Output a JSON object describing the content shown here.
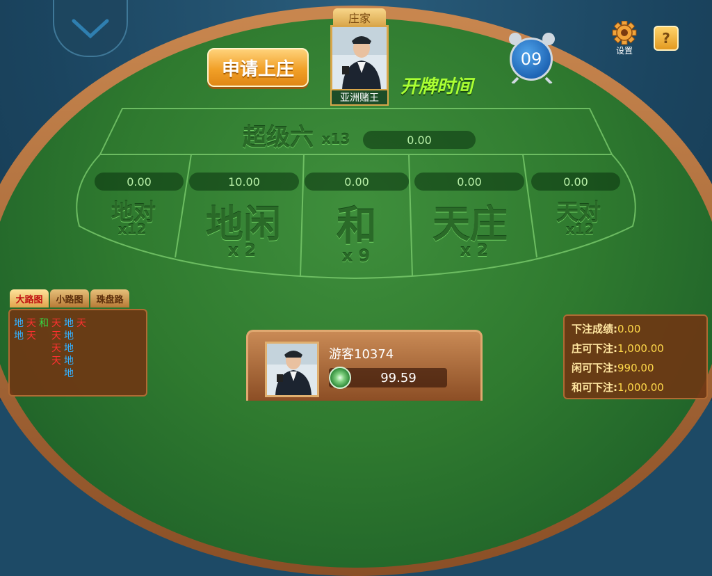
{
  "banker": {
    "tag": "庄家",
    "name": "亚洲赌王"
  },
  "apply_button": "申请上庄",
  "timer": {
    "label": "开牌时间",
    "seconds": "09"
  },
  "settings_label": "设置",
  "help_label": "?",
  "bets": {
    "super_six": {
      "label": "超级六",
      "mult": "x13",
      "amount": "0.00"
    },
    "di_pair": {
      "label": "地对",
      "mult": "x12",
      "amount": "0.00"
    },
    "di_xian": {
      "label": "地闲",
      "mult": "x 2",
      "amount": "10.00"
    },
    "tie": {
      "label": "和",
      "mult": "x 9",
      "amount": "0.00"
    },
    "tian_zhuang": {
      "label": "天庄",
      "mult": "x 2",
      "amount": "0.00"
    },
    "tian_pair": {
      "label": "天对",
      "mult": "x12",
      "amount": "0.00"
    }
  },
  "road": {
    "tabs": [
      "大路图",
      "小路图",
      "珠盘路"
    ],
    "columns": [
      [
        "地",
        "地"
      ],
      [
        "天",
        "天"
      ],
      [
        "和"
      ],
      [
        "天",
        "天",
        "天",
        "天"
      ],
      [
        "地",
        "地",
        "地",
        "地",
        "地"
      ],
      [
        "天"
      ]
    ],
    "colors": {
      "天": "#ff3030",
      "地": "#33b0ff",
      "和": "#33dd44"
    }
  },
  "player": {
    "name": "游客10374",
    "coins": "99.59"
  },
  "stats": [
    {
      "key": "下注成绩:",
      "value": "0.00"
    },
    {
      "key": "庄可下注:",
      "value": "1,000.00"
    },
    {
      "key": "闲可下注:",
      "value": "990.00"
    },
    {
      "key": "和可下注:",
      "value": "1,000.00"
    }
  ]
}
